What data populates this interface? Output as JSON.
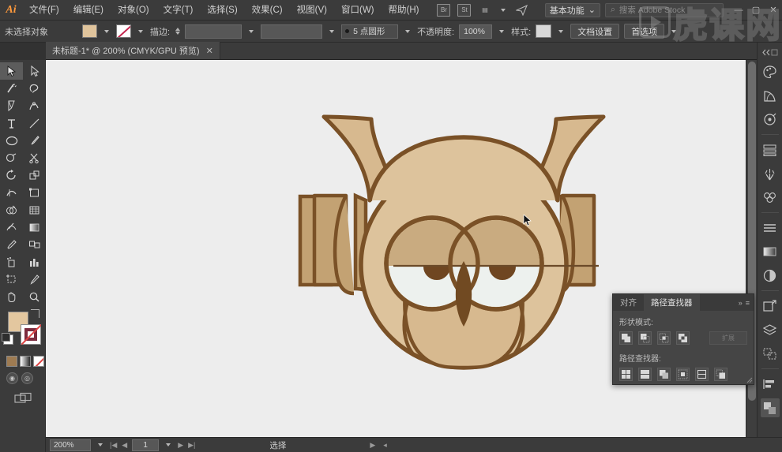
{
  "app": {
    "name": "Adobe Illustrator",
    "logo_text": "Ai"
  },
  "menubar": {
    "items": [
      {
        "label": "文件(F)",
        "name": "menu-file"
      },
      {
        "label": "编辑(E)",
        "name": "menu-edit"
      },
      {
        "label": "对象(O)",
        "name": "menu-object"
      },
      {
        "label": "文字(T)",
        "name": "menu-type"
      },
      {
        "label": "选择(S)",
        "name": "menu-select"
      },
      {
        "label": "效果(C)",
        "name": "menu-effect"
      },
      {
        "label": "视图(V)",
        "name": "menu-view"
      },
      {
        "label": "窗口(W)",
        "name": "menu-window"
      },
      {
        "label": "帮助(H)",
        "name": "menu-help"
      }
    ],
    "bridge_icon": "Br",
    "stock_icon": "St",
    "arrange_icon": "▤",
    "workspace": {
      "label": "基本功能",
      "caret": "⌄"
    },
    "stock_search": {
      "icon": "⌕",
      "placeholder": "搜索 Adobe Stock",
      "value": ""
    },
    "window_controls": {
      "minimize": "—",
      "maximize": "▢",
      "close": "✕"
    }
  },
  "controlbar": {
    "selection_status": "未选择对象",
    "fill_label": "填色",
    "stroke_swatch_label": "描边颜色",
    "stroke_label": "描边:",
    "stroke_weight_value": "",
    "stroke_profile_value": "",
    "brush_label": "5 点圆形",
    "opacity_label": "不透明度:",
    "opacity_value": "100%",
    "style_label": "样式:",
    "doc_setup_button": "文档设置",
    "preferences_button": "首选项"
  },
  "document_tab": {
    "title": "未标题-1* @ 200% (CMYK/GPU 预览)",
    "close_glyph": "✕"
  },
  "toolbar": {
    "tools": [
      {
        "name": "selection-tool",
        "label": "选择工具",
        "active": true
      },
      {
        "name": "direct-selection-tool",
        "label": "直接选择工具",
        "active": false
      },
      {
        "name": "magic-wand-tool",
        "label": "魔棒工具",
        "active": false
      },
      {
        "name": "lasso-tool",
        "label": "套索工具",
        "active": false
      },
      {
        "name": "pen-tool",
        "label": "钢笔工具",
        "active": false
      },
      {
        "name": "curvature-tool",
        "label": "曲率工具",
        "active": false
      },
      {
        "name": "type-tool",
        "label": "文字工具",
        "active": false
      },
      {
        "name": "line-segment-tool",
        "label": "直线段工具",
        "active": false
      },
      {
        "name": "ellipse-tool",
        "label": "椭圆工具",
        "active": false
      },
      {
        "name": "paintbrush-tool",
        "label": "画笔工具",
        "active": false
      },
      {
        "name": "shaper-tool",
        "label": "Shaper 工具",
        "active": false
      },
      {
        "name": "scissors-tool",
        "label": "剪刀工具",
        "active": false
      },
      {
        "name": "rotate-tool",
        "label": "旋转工具",
        "active": false
      },
      {
        "name": "scale-tool",
        "label": "比例缩放工具",
        "active": false
      },
      {
        "name": "width-tool",
        "label": "宽度工具",
        "active": false
      },
      {
        "name": "free-transform-tool",
        "label": "自由变换工具",
        "active": false
      },
      {
        "name": "shape-builder-tool",
        "label": "形状生成器工具",
        "active": false
      },
      {
        "name": "perspective-grid-tool",
        "label": "透视网格工具",
        "active": false
      },
      {
        "name": "mesh-tool",
        "label": "网格工具",
        "active": false
      },
      {
        "name": "gradient-tool",
        "label": "渐变工具",
        "active": false
      },
      {
        "name": "eyedropper-tool",
        "label": "吸管工具",
        "active": false
      },
      {
        "name": "blend-tool",
        "label": "混合工具",
        "active": false
      },
      {
        "name": "symbol-sprayer-tool",
        "label": "符号喷枪工具",
        "active": false
      },
      {
        "name": "column-graph-tool",
        "label": "柱形图工具",
        "active": false
      },
      {
        "name": "artboard-tool",
        "label": "画板工具",
        "active": false
      },
      {
        "name": "slice-tool",
        "label": "切片工具",
        "active": false
      },
      {
        "name": "hand-tool",
        "label": "抓手工具",
        "active": false
      },
      {
        "name": "zoom-tool",
        "label": "缩放工具",
        "active": false
      }
    ],
    "colors": {
      "fill_color": "#e3c79f",
      "stroke_color": "#7b2b3e",
      "fill_label": "填色",
      "stroke_label": "描边",
      "swap_label": "互换填色和描边",
      "default_label": "默认填色和描边",
      "mode_color_label": "颜色",
      "mode_gradient_label": "渐变",
      "mode_none_label": "无",
      "screen_normal_label": "正常屏幕模式",
      "screen_full_label": "全屏模式",
      "docs_label": "更改屏幕模式"
    }
  },
  "canvas": {
    "background": "#ededed",
    "artwork_name": "owl-illustration",
    "colors": {
      "body_fill": "#d7b98f",
      "body_fill_light": "#ddc39c",
      "outline": "#7a5127",
      "wing_fill": "#c3a273",
      "eye_white": "#edf1ee",
      "pupil": "#6f4621",
      "eyelid": "#c9ab80",
      "beak": "#714a22",
      "antenna": "#5f4421"
    },
    "cursor": "arrow-pointer"
  },
  "pathfinder_panel": {
    "tabs": [
      {
        "label": "对齐",
        "name": "panel-tab-align",
        "active": false
      },
      {
        "label": "路径查找器",
        "name": "panel-tab-pathfinder",
        "active": true
      }
    ],
    "collapse_icon": "»",
    "menu_icon": "≡",
    "shape_modes_label": "形状模式:",
    "shape_mode_buttons": [
      {
        "name": "unite-button",
        "label": "联集"
      },
      {
        "name": "minus-front-button",
        "label": "减去顶层"
      },
      {
        "name": "intersect-button",
        "label": "交集"
      },
      {
        "name": "exclude-button",
        "label": "差集"
      }
    ],
    "expand_button": "扩展",
    "pathfinders_label": "路径查找器:",
    "pathfinder_buttons": [
      {
        "name": "divide-button",
        "label": "分割"
      },
      {
        "name": "trim-button",
        "label": "修边"
      },
      {
        "name": "merge-button",
        "label": "合并"
      },
      {
        "name": "crop-button",
        "label": "裁剪"
      },
      {
        "name": "outline-button",
        "label": "轮廓"
      },
      {
        "name": "minus-back-button",
        "label": "减去后方对象"
      }
    ]
  },
  "right_dock": {
    "items": [
      {
        "name": "dock-color",
        "label": "颜色"
      },
      {
        "name": "dock-color-guide",
        "label": "颜色参考"
      },
      {
        "name": "dock-swatches",
        "label": "色板"
      },
      {
        "name": "dock-brushes",
        "label": "画笔"
      },
      {
        "name": "dock-symbols",
        "label": "符号"
      },
      {
        "name": "dock-stroke",
        "label": "描边"
      },
      {
        "name": "dock-gradient",
        "label": "渐变"
      },
      {
        "name": "dock-transparency",
        "label": "透明度"
      },
      {
        "name": "dock-appearance",
        "label": "外观"
      },
      {
        "name": "dock-layers",
        "label": "图层"
      },
      {
        "name": "dock-artboards",
        "label": "画板"
      },
      {
        "name": "dock-align",
        "label": "对齐"
      },
      {
        "name": "dock-pathfinder",
        "label": "路径查找器"
      }
    ]
  },
  "statusbar": {
    "zoom_value": "200%",
    "zoom_caret": "⌄",
    "page_first": "|◀",
    "page_prev": "◀",
    "page_value": "1",
    "page_caret": "⌄",
    "page_next": "▶",
    "page_last": "▶|",
    "status_text": "选择",
    "status_caret": "▶",
    "grip": "◂"
  },
  "watermark": {
    "text": "虎课网"
  }
}
